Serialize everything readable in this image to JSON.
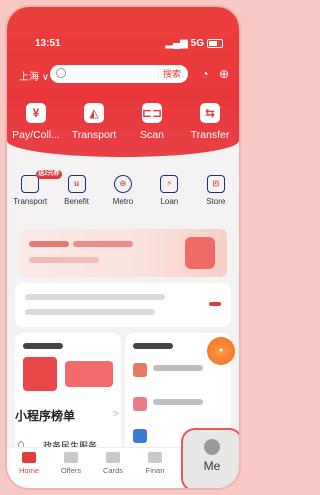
{
  "status": {
    "time": "13:51",
    "signal": "5G"
  },
  "header": {
    "city": "上海 ∨",
    "search_button": "搜索"
  },
  "main_actions": [
    {
      "label": "Pay/Coll...",
      "glyph": "¥"
    },
    {
      "label": "Transport",
      "glyph": "◭"
    },
    {
      "label": "Scan",
      "glyph": "⊏⊐"
    },
    {
      "label": "Transfer",
      "glyph": "⇆"
    }
  ],
  "services": [
    {
      "label": "Transport",
      "badge": "送2元券"
    },
    {
      "label": "Benefit",
      "glyph": "u"
    },
    {
      "label": "Metro",
      "glyph": "⊖"
    },
    {
      "label": "Loan",
      "glyph": "⚡"
    },
    {
      "label": "Store",
      "glyph": "⊡"
    }
  ],
  "mini_programs": {
    "title": "小程序榜单",
    "arrow": ">",
    "item": "政务民生服务"
  },
  "tabs": [
    {
      "label": "Home",
      "active": true
    },
    {
      "label": "Offers",
      "active": false
    },
    {
      "label": "Cards",
      "active": false
    },
    {
      "label": "Finan",
      "active": false
    }
  ],
  "me_tab": {
    "label": "Me"
  },
  "colors": {
    "brand_red": "#e9383b",
    "nav_blue": "#1e2d78"
  }
}
